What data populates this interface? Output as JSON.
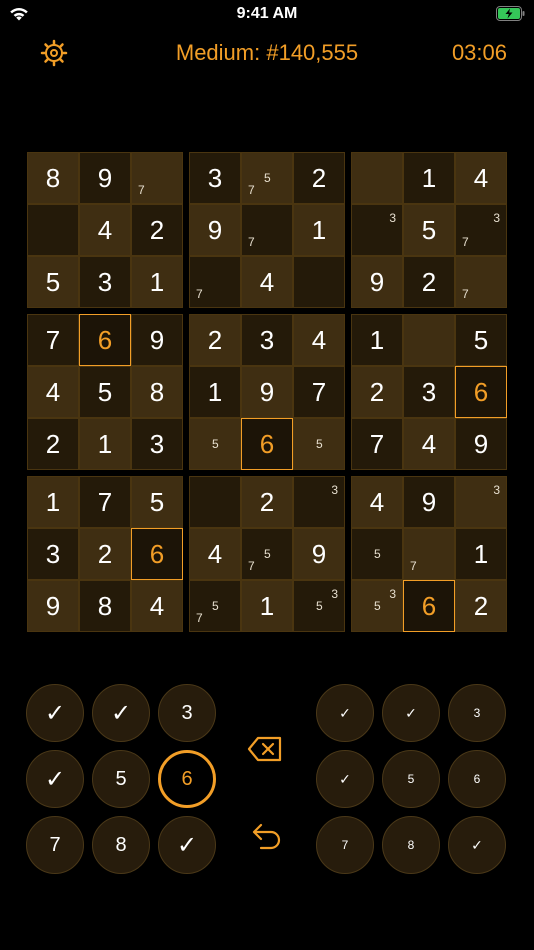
{
  "status": {
    "time": "9:41 AM"
  },
  "header": {
    "title": "Medium: #140,555",
    "timer": "03:06"
  },
  "board": {
    "rows": [
      [
        {
          "v": "8"
        },
        {
          "v": "9"
        },
        {
          "v": "",
          "c": [
            "7"
          ]
        },
        {
          "v": "3"
        },
        {
          "v": "",
          "c": [
            "7",
            "5"
          ]
        },
        {
          "v": "2"
        },
        {
          "v": ""
        },
        {
          "v": "1"
        },
        {
          "v": "4"
        }
      ],
      [
        {
          "v": ""
        },
        {
          "v": "4"
        },
        {
          "v": "2"
        },
        {
          "v": "9"
        },
        {
          "v": "",
          "c": [
            "7"
          ]
        },
        {
          "v": "1"
        },
        {
          "v": "",
          "c": [
            "3"
          ]
        },
        {
          "v": "5"
        },
        {
          "v": "",
          "c": [
            "3",
            "7"
          ]
        }
      ],
      [
        {
          "v": "5"
        },
        {
          "v": "3"
        },
        {
          "v": "1"
        },
        {
          "v": "",
          "c": [
            "7"
          ]
        },
        {
          "v": "4"
        },
        {
          "v": ""
        },
        {
          "v": "9"
        },
        {
          "v": "2"
        },
        {
          "v": "",
          "c": [
            "7"
          ]
        }
      ],
      [
        {
          "v": "7"
        },
        {
          "v": "6",
          "sel": true
        },
        {
          "v": "9"
        },
        {
          "v": "2"
        },
        {
          "v": "3"
        },
        {
          "v": "4"
        },
        {
          "v": "1"
        },
        {
          "v": ""
        },
        {
          "v": "5"
        }
      ],
      [
        {
          "v": "4"
        },
        {
          "v": "5"
        },
        {
          "v": "8"
        },
        {
          "v": "1"
        },
        {
          "v": "9"
        },
        {
          "v": "7"
        },
        {
          "v": "2"
        },
        {
          "v": "3"
        },
        {
          "v": "6",
          "sel": true
        }
      ],
      [
        {
          "v": "2"
        },
        {
          "v": "1"
        },
        {
          "v": "3"
        },
        {
          "v": "",
          "c": [
            "5"
          ]
        },
        {
          "v": "6",
          "sel": true
        },
        {
          "v": "",
          "c": [
            "5"
          ]
        },
        {
          "v": "7"
        },
        {
          "v": "4"
        },
        {
          "v": "9"
        }
      ],
      [
        {
          "v": "1"
        },
        {
          "v": "7"
        },
        {
          "v": "5"
        },
        {
          "v": ""
        },
        {
          "v": "2"
        },
        {
          "v": "",
          "c": [
            "3"
          ]
        },
        {
          "v": "4"
        },
        {
          "v": "9"
        },
        {
          "v": "",
          "c": [
            "3"
          ]
        }
      ],
      [
        {
          "v": "3"
        },
        {
          "v": "2"
        },
        {
          "v": "6",
          "sel": true
        },
        {
          "v": "4"
        },
        {
          "v": "",
          "c": [
            "7",
            "5"
          ]
        },
        {
          "v": "9"
        },
        {
          "v": "",
          "c": [
            "5"
          ]
        },
        {
          "v": "",
          "c": [
            "7"
          ]
        },
        {
          "v": "1"
        }
      ],
      [
        {
          "v": "9"
        },
        {
          "v": "8"
        },
        {
          "v": "4"
        },
        {
          "v": "",
          "c": [
            "7",
            "5"
          ]
        },
        {
          "v": "1"
        },
        {
          "v": "",
          "c": [
            "5",
            "3"
          ]
        },
        {
          "v": "",
          "c": [
            "5",
            "3"
          ]
        },
        {
          "v": "6",
          "sel": true
        },
        {
          "v": "2"
        }
      ]
    ]
  },
  "keypad_left": [
    {
      "label": "✓",
      "done": true
    },
    {
      "label": "✓",
      "done": true
    },
    {
      "label": "3"
    },
    {
      "label": "✓",
      "done": true
    },
    {
      "label": "5"
    },
    {
      "label": "6",
      "active": true
    },
    {
      "label": "7"
    },
    {
      "label": "8"
    },
    {
      "label": "✓",
      "done": true
    }
  ],
  "keypad_right": [
    {
      "label": "✓",
      "done": true
    },
    {
      "label": "✓",
      "done": true
    },
    {
      "label": "3"
    },
    {
      "label": "✓",
      "done": true
    },
    {
      "label": "5"
    },
    {
      "label": "6"
    },
    {
      "label": "7"
    },
    {
      "label": "8"
    },
    {
      "label": "✓",
      "done": true
    }
  ],
  "colors": {
    "accent": "#f29e27",
    "cell_light": "#3f2e12",
    "cell_dark": "#241a09"
  },
  "icons": {
    "settings": "gear-icon",
    "delete": "backspace-icon",
    "undo": "undo-icon"
  }
}
